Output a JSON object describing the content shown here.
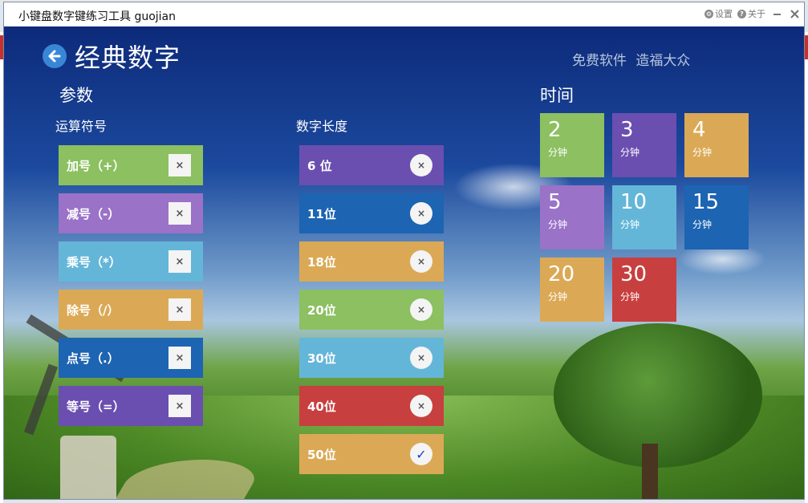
{
  "window": {
    "title": "小键盘数字键练习工具 guojian",
    "settings_label": "设置",
    "about_label": "关于"
  },
  "header": {
    "title": "经典数字",
    "slogan": "免费软件  造福大众"
  },
  "params": {
    "section_title": "参数",
    "operators_title": "运算符号",
    "length_title": "数字长度",
    "operators": [
      {
        "label": "加号（+）",
        "color": "#8cc060",
        "checked": false
      },
      {
        "label": "减号（-）",
        "color": "#9a72c8",
        "checked": false
      },
      {
        "label": "乘号（*）",
        "color": "#64b6d8",
        "checked": false
      },
      {
        "label": "除号（/）",
        "color": "#dba955",
        "checked": false
      },
      {
        "label": "点号（.）",
        "color": "#1d64b2",
        "checked": false
      },
      {
        "label": "等号（=）",
        "color": "#6a4fb0",
        "checked": false
      }
    ],
    "lengths": [
      {
        "label": "6 位",
        "color": "#6a4fb0",
        "checked": false
      },
      {
        "label": "11位",
        "color": "#1d64b2",
        "checked": false
      },
      {
        "label": "18位",
        "color": "#dba955",
        "checked": false
      },
      {
        "label": "20位",
        "color": "#8cc060",
        "checked": false
      },
      {
        "label": "30位",
        "color": "#64b6d8",
        "checked": false
      },
      {
        "label": "40位",
        "color": "#c83f3f",
        "checked": false
      },
      {
        "label": "50位",
        "color": "#dba955",
        "checked": true
      }
    ],
    "check_on": "✓",
    "check_off": "×"
  },
  "time": {
    "section_title": "时间",
    "unit": "分钟",
    "tiles": [
      {
        "value": "2",
        "color": "#8cc060"
      },
      {
        "value": "3",
        "color": "#6a4fb0"
      },
      {
        "value": "4",
        "color": "#dba955"
      },
      {
        "value": "5",
        "color": "#9a72c8"
      },
      {
        "value": "10",
        "color": "#64b6d8"
      },
      {
        "value": "15",
        "color": "#1d64b2"
      },
      {
        "value": "20",
        "color": "#dba955"
      },
      {
        "value": "30",
        "color": "#c83f3f"
      }
    ]
  },
  "icons": {
    "back": "back-arrow-icon",
    "settings": "settings-icon",
    "about": "help-icon",
    "minimize": "minimize-icon",
    "close": "close-icon"
  }
}
